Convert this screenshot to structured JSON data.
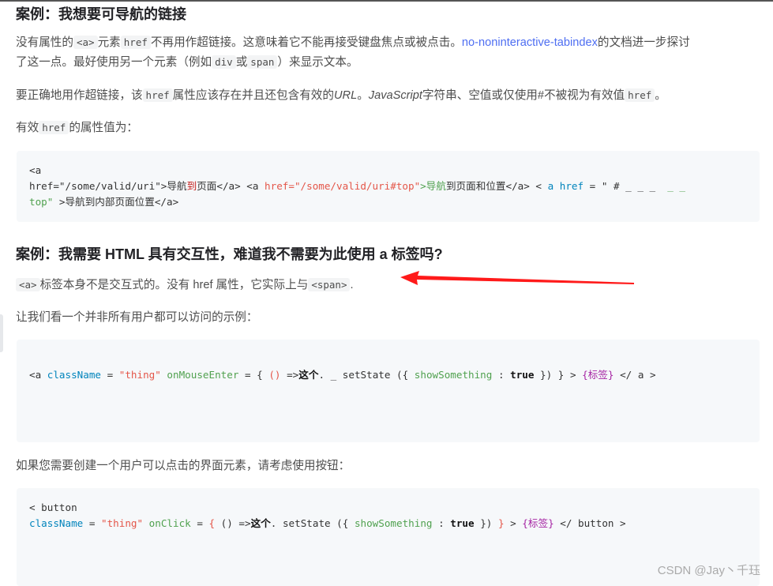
{
  "sec1": {
    "title": "案例：我想要可导航的链接",
    "p1": {
      "a": "没有属性的",
      "code_a": "<a>",
      "b": "元素",
      "code_href": "href",
      "c": "不再用作超链接。这意味着它不能再接受键盘焦点或被点击。",
      "link": "no-noninteractive-tabindex",
      "d": "的文档进一步探讨",
      "line2a": "了这一点。最好使用另一个元素（例如",
      "code_div": "div",
      "or": "或",
      "code_span": "span",
      "line2b": "）来显示文本。"
    },
    "p2": {
      "a": "要正确地用作超链接，该",
      "code_href": "href",
      "b": "属性应该存在并且还包含有效的",
      "url": "URL",
      "c": "。",
      "js": "JavaScript",
      "d": "字符串、空值或仅使用#不被视为有效值",
      "code_href2": "href",
      "e": "。"
    },
    "p3": {
      "a": "有效",
      "code_href": "href",
      "b": "的属性值为："
    },
    "code": {
      "l1": "<a",
      "l2a": "href=\"/some/valid/uri\">",
      "l2b": "导航",
      "l2c": "到",
      "l2d": "页面</a> <a ",
      "l2e": "href=\"/some/valid/uri#top\"",
      "l2f": ">导航",
      "l2g": "到页面和位置</a> < ",
      "l2h": "a href",
      "l2i": " = \" # _ _ _  ",
      "l2j": "_ _",
      "l3a": "top\"",
      "l3b": " >导航到内部页面位置</a>"
    }
  },
  "sec2": {
    "title": "案例：我需要 HTML 具有交互性，难道我不需要为此使用 a 标签吗?",
    "p1": {
      "code_a": "<a>",
      "a": "标签本身不是交互式的。没有 href 属性，它实际上与",
      "code_span": "<span>",
      "b": "."
    },
    "p2": "让我们看一个并非所有用户都可以访问的示例：",
    "code1": {
      "a": "<a ",
      "b": "className",
      "c": " = ",
      "d": "\"thing\"",
      "e": " ",
      "f": "onMouseEnter",
      "g": " = { ",
      "h": "()",
      "i": " =>",
      "j": "这个",
      "k": ". _ setState ({ ",
      "l": "showSomething",
      "m": " : ",
      "n": "true",
      "o": " }) } > ",
      "p": "{标签}",
      "q": " </ a >"
    },
    "p3": "如果您需要创建一个用户可以点击的界面元素，请考虑使用按钮：",
    "code2": {
      "l1": "< button",
      "a": "className",
      "b": " = ",
      "c": "\"thing\"",
      "d": " ",
      "e": "onClick",
      "f": " = ",
      "g": "{",
      "h": " () =>",
      "i": "这个",
      "j": ". setState ({ ",
      "k": "showSomething",
      "l": " : ",
      "m": "true",
      "n": " }) ",
      "o": "}",
      "p": " > ",
      "q": "{标签}",
      "r": " </ button >"
    }
  },
  "watermark": "CSDN @Jay丶千珏",
  "colors": {
    "arrow": "#ff1a1a",
    "link": "#4e6ef2",
    "code_bg": "#f6f8fa"
  }
}
